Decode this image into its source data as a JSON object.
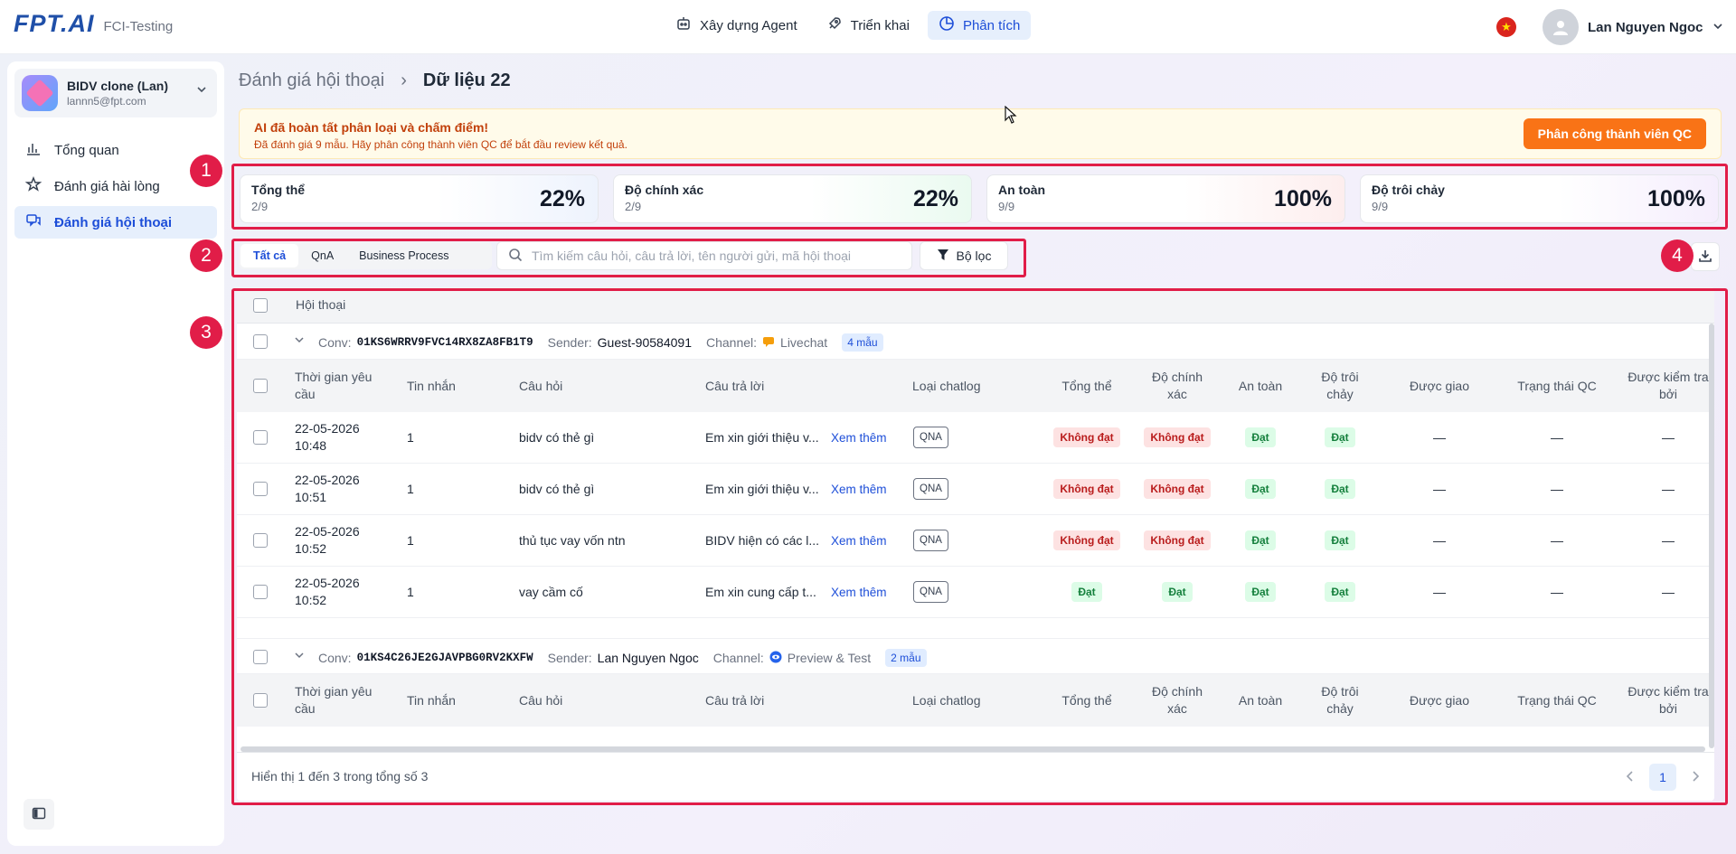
{
  "brand": {
    "logo_text": "FPT.AI",
    "org": "FCI-Testing"
  },
  "nav": [
    {
      "label": "Xây dựng Agent",
      "icon": "robot-icon"
    },
    {
      "label": "Triển khai",
      "icon": "rocket-icon"
    },
    {
      "label": "Phân tích",
      "icon": "chart-pie-icon",
      "active": true
    }
  ],
  "user": {
    "name": "Lan Nguyen Ngoc",
    "flag": "★"
  },
  "workspace": {
    "name": "BIDV clone (Lan)",
    "email": "lannn5@fpt.com"
  },
  "sidebar": {
    "items": [
      {
        "label": "Tổng quan",
        "icon": "bar-chart-icon"
      },
      {
        "label": "Đánh giá hài lòng",
        "icon": "star-icon"
      },
      {
        "label": "Đánh giá hội thoại",
        "icon": "chat-icon",
        "active": true
      }
    ]
  },
  "breadcrumb": {
    "parent": "Đánh giá hội thoại",
    "sep": "›",
    "current": "Dữ liệu 22"
  },
  "banner": {
    "title": "AI đã hoàn tất phân loại và chấm điểm!",
    "subtitle": "Đã đánh giá 9 mẫu. Hãy phân công thành viên QC để bắt đầu review kết quả.",
    "button": "Phân công thành viên QC",
    "color": "#f97316"
  },
  "annotations": [
    "1",
    "2",
    "3",
    "4"
  ],
  "metrics": [
    {
      "label": "Tổng thể",
      "sub": "2/9",
      "value": "22%"
    },
    {
      "label": "Độ chính xác",
      "sub": "2/9",
      "value": "22%"
    },
    {
      "label": "An toàn",
      "sub": "9/9",
      "value": "100%"
    },
    {
      "label": "Độ trôi chảy",
      "sub": "9/9",
      "value": "100%"
    }
  ],
  "tabs": [
    "Tất cả",
    "QnA",
    "Business Process"
  ],
  "search": {
    "placeholder": "Tìm kiếm câu hỏi, câu trả lời, tên người gửi, mã hội thoại",
    "value": ""
  },
  "filter_label": "Bộ lọc",
  "table": {
    "main_header": "Hội thoại",
    "columns": [
      "Thời gian yêu cầu",
      "Tin nhắn",
      "Câu hỏi",
      "Câu trả lời",
      "Loại chatlog",
      "Tổng thể",
      "Độ chính xác",
      "An toàn",
      "Độ trôi chảy",
      "Được giao",
      "Trạng thái QC",
      "Được kiểm tra bởi"
    ],
    "conversations": [
      {
        "conv_label": "Conv:",
        "conv_id": "01KS6WRRV9FVC14RX8ZA8FB1T9",
        "sender_label": "Sender:",
        "sender": "Guest-90584091",
        "channel_label": "Channel:",
        "channel": "Livechat",
        "count": "4 mẫu",
        "rows": [
          {
            "date": "22-05-2026",
            "time": "10:48",
            "msgs": "1",
            "question": "bidv có thẻ gì",
            "answer": "Em xin giới thiệu v...",
            "more": "Xem thêm",
            "type": "QNA",
            "overall": "Không đạt",
            "accuracy": "Không đạt",
            "safety": "Đạt",
            "fluency": "Đạt",
            "assigned": "—",
            "qc": "—",
            "checked": "—"
          },
          {
            "date": "22-05-2026",
            "time": "10:51",
            "msgs": "1",
            "question": "bidv có thẻ gì",
            "answer": "Em xin giới thiệu v...",
            "more": "Xem thêm",
            "type": "QNA",
            "overall": "Không đạt",
            "accuracy": "Không đạt",
            "safety": "Đạt",
            "fluency": "Đạt",
            "assigned": "—",
            "qc": "—",
            "checked": "—"
          },
          {
            "date": "22-05-2026",
            "time": "10:52",
            "msgs": "1",
            "question": "thủ tục vay vốn ntn",
            "answer": "BIDV hiện có các l...",
            "more": "Xem thêm",
            "type": "QNA",
            "overall": "Không đạt",
            "accuracy": "Không đạt",
            "safety": "Đạt",
            "fluency": "Đạt",
            "assigned": "—",
            "qc": "—",
            "checked": "—"
          },
          {
            "date": "22-05-2026",
            "time": "10:52",
            "msgs": "1",
            "question": "vay cầm cố",
            "answer": "Em xin cung cấp t...",
            "more": "Xem thêm",
            "type": "QNA",
            "overall": "Đạt",
            "accuracy": "Đạt",
            "safety": "Đạt",
            "fluency": "Đạt",
            "assigned": "—",
            "qc": "—",
            "checked": "—"
          }
        ]
      },
      {
        "conv_label": "Conv:",
        "conv_id": "01KS4C26JE2GJAVPBG0RV2KXFW",
        "sender_label": "Sender:",
        "sender": "Lan Nguyen Ngoc",
        "channel_label": "Channel:",
        "channel": "Preview & Test",
        "count": "2 mẫu",
        "rows": []
      }
    ]
  },
  "footer": {
    "summary": "Hiển thị 1 đến 3 trong tổng số 3",
    "page": "1"
  }
}
